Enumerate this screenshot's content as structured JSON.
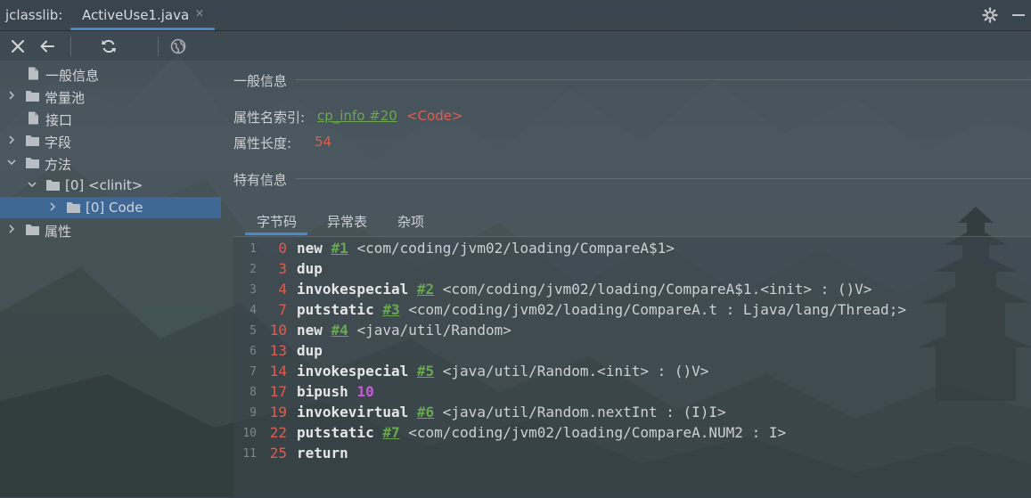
{
  "window": {
    "app_title": "jclasslib:",
    "tab_label": "ActiveUse1.java",
    "tab_close": "×"
  },
  "icons": [
    "gear-icon",
    "minimize-icon",
    "close-icon",
    "back-arrow-icon",
    "refresh-icon",
    "globe-icon",
    "file-icon",
    "folder-icon",
    "chevron-right-icon",
    "chevron-down-icon"
  ],
  "colors": {
    "accent": "#4a88c7",
    "link": "#6aa84f",
    "value_red": "#e05c4f",
    "number_purple": "#c75ad6",
    "selection": "#3c6eaa"
  },
  "tree": [
    {
      "label": "一般信息",
      "icon": "file-icon",
      "expander": "none",
      "depth": 1
    },
    {
      "label": "常量池",
      "icon": "folder-icon",
      "expander": "collapsed",
      "depth": 0
    },
    {
      "label": "接口",
      "icon": "file-icon",
      "expander": "none",
      "depth": 1
    },
    {
      "label": "字段",
      "icon": "folder-icon",
      "expander": "collapsed",
      "depth": 0
    },
    {
      "label": "方法",
      "icon": "folder-icon",
      "expander": "expanded",
      "depth": 0
    },
    {
      "label": "[0] <clinit>",
      "icon": "folder-icon",
      "expander": "expanded",
      "depth": 1
    },
    {
      "label": "[0] Code",
      "icon": "folder-icon",
      "expander": "collapsed",
      "depth": 2,
      "selected": true
    },
    {
      "label": "属性",
      "icon": "folder-icon",
      "expander": "collapsed",
      "depth": 0
    }
  ],
  "general": {
    "title": "一般信息",
    "name_index_label": "属性名索引:",
    "name_index_link": "cp_info #20",
    "name_index_value": "<Code>",
    "length_label": "属性长度:",
    "length_value": "54"
  },
  "specific": {
    "title": "特有信息",
    "tabs": [
      "字节码",
      "异常表",
      "杂项"
    ],
    "active_tab": "字节码"
  },
  "bytecode": [
    {
      "line": "1",
      "offset": "0",
      "op": "new",
      "ref": "#1",
      "arg": "",
      "comment": "<com/coding/jvm02/loading/CompareA$1>"
    },
    {
      "line": "2",
      "offset": "3",
      "op": "dup",
      "ref": "",
      "arg": "",
      "comment": ""
    },
    {
      "line": "3",
      "offset": "4",
      "op": "invokespecial",
      "ref": "#2",
      "arg": "",
      "comment": "<com/coding/jvm02/loading/CompareA$1.<init> : ()V>"
    },
    {
      "line": "4",
      "offset": "7",
      "op": "putstatic",
      "ref": "#3",
      "arg": "",
      "comment": "<com/coding/jvm02/loading/CompareA.t : Ljava/lang/Thread;>"
    },
    {
      "line": "5",
      "offset": "10",
      "op": "new",
      "ref": "#4",
      "arg": "",
      "comment": "<java/util/Random>"
    },
    {
      "line": "6",
      "offset": "13",
      "op": "dup",
      "ref": "",
      "arg": "",
      "comment": ""
    },
    {
      "line": "7",
      "offset": "14",
      "op": "invokespecial",
      "ref": "#5",
      "arg": "",
      "comment": "<java/util/Random.<init> : ()V>"
    },
    {
      "line": "8",
      "offset": "17",
      "op": "bipush",
      "ref": "",
      "arg": "10",
      "comment": ""
    },
    {
      "line": "9",
      "offset": "19",
      "op": "invokevirtual",
      "ref": "#6",
      "arg": "",
      "comment": "<java/util/Random.nextInt : (I)I>"
    },
    {
      "line": "10",
      "offset": "22",
      "op": "putstatic",
      "ref": "#7",
      "arg": "",
      "comment": "<com/coding/jvm02/loading/CompareA.NUM2 : I>"
    },
    {
      "line": "11",
      "offset": "25",
      "op": "return",
      "ref": "",
      "arg": "",
      "comment": ""
    }
  ]
}
